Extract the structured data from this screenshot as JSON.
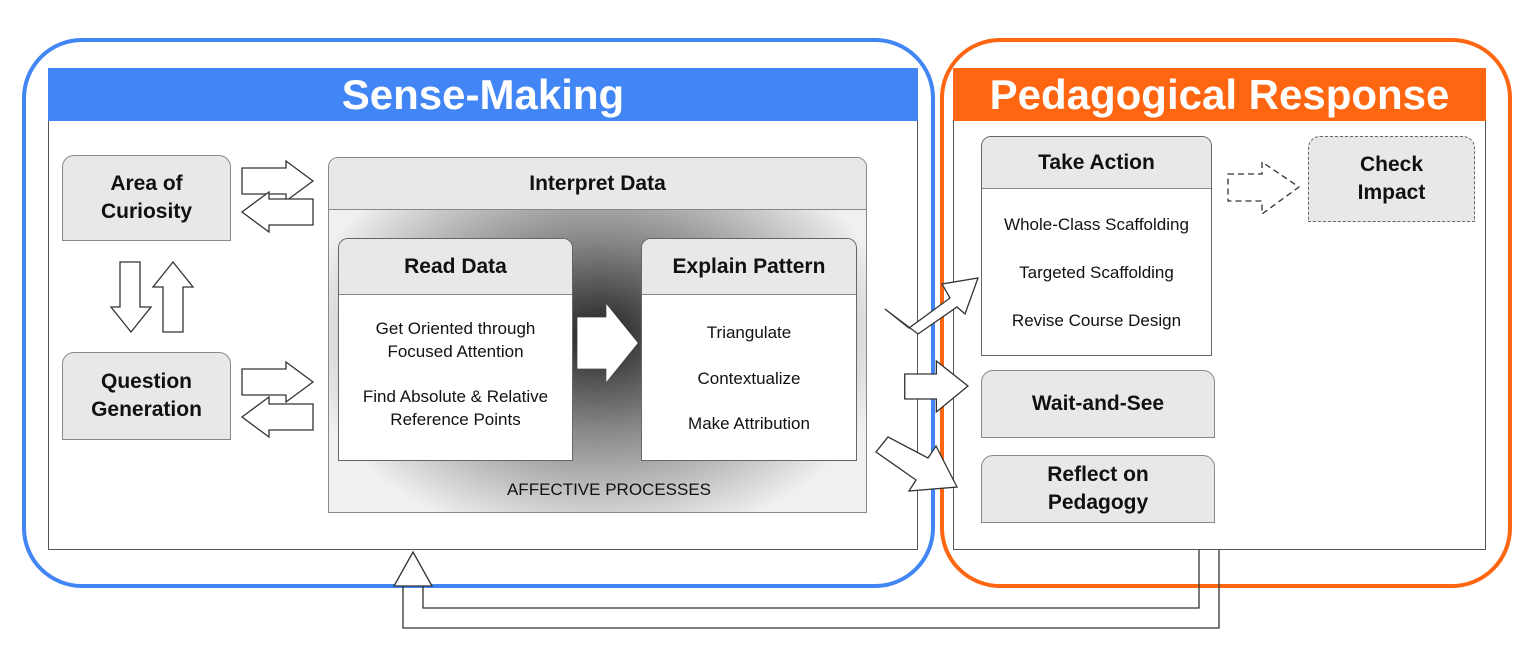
{
  "colors": {
    "sense_making": "#4285f4",
    "pedagogical_response": "#ff6611",
    "box_fill": "#e8e8e8"
  },
  "sense_making": {
    "title": "Sense-Making",
    "area_of_curiosity": "Area of Curiosity",
    "question_generation": "Question Generation",
    "interpret_data": {
      "title": "Interpret Data",
      "read_data": {
        "title": "Read Data",
        "items": [
          "Get Oriented through Focused Attention",
          "Find Absolute & Relative Reference Points"
        ]
      },
      "explain_pattern": {
        "title": "Explain Pattern",
        "items": [
          "Triangulate",
          "Contextualize",
          "Make Attribution"
        ]
      },
      "affective": "AFFECTIVE PROCESSES"
    }
  },
  "pedagogical_response": {
    "title": "Pedagogical Response",
    "take_action": {
      "title": "Take Action",
      "items": [
        "Whole-Class Scaffolding",
        "Targeted Scaffolding",
        "Revise Course Design"
      ]
    },
    "check_impact": "Check Impact",
    "wait_and_see": "Wait-and-See",
    "reflect": "Reflect on Pedagogy"
  }
}
